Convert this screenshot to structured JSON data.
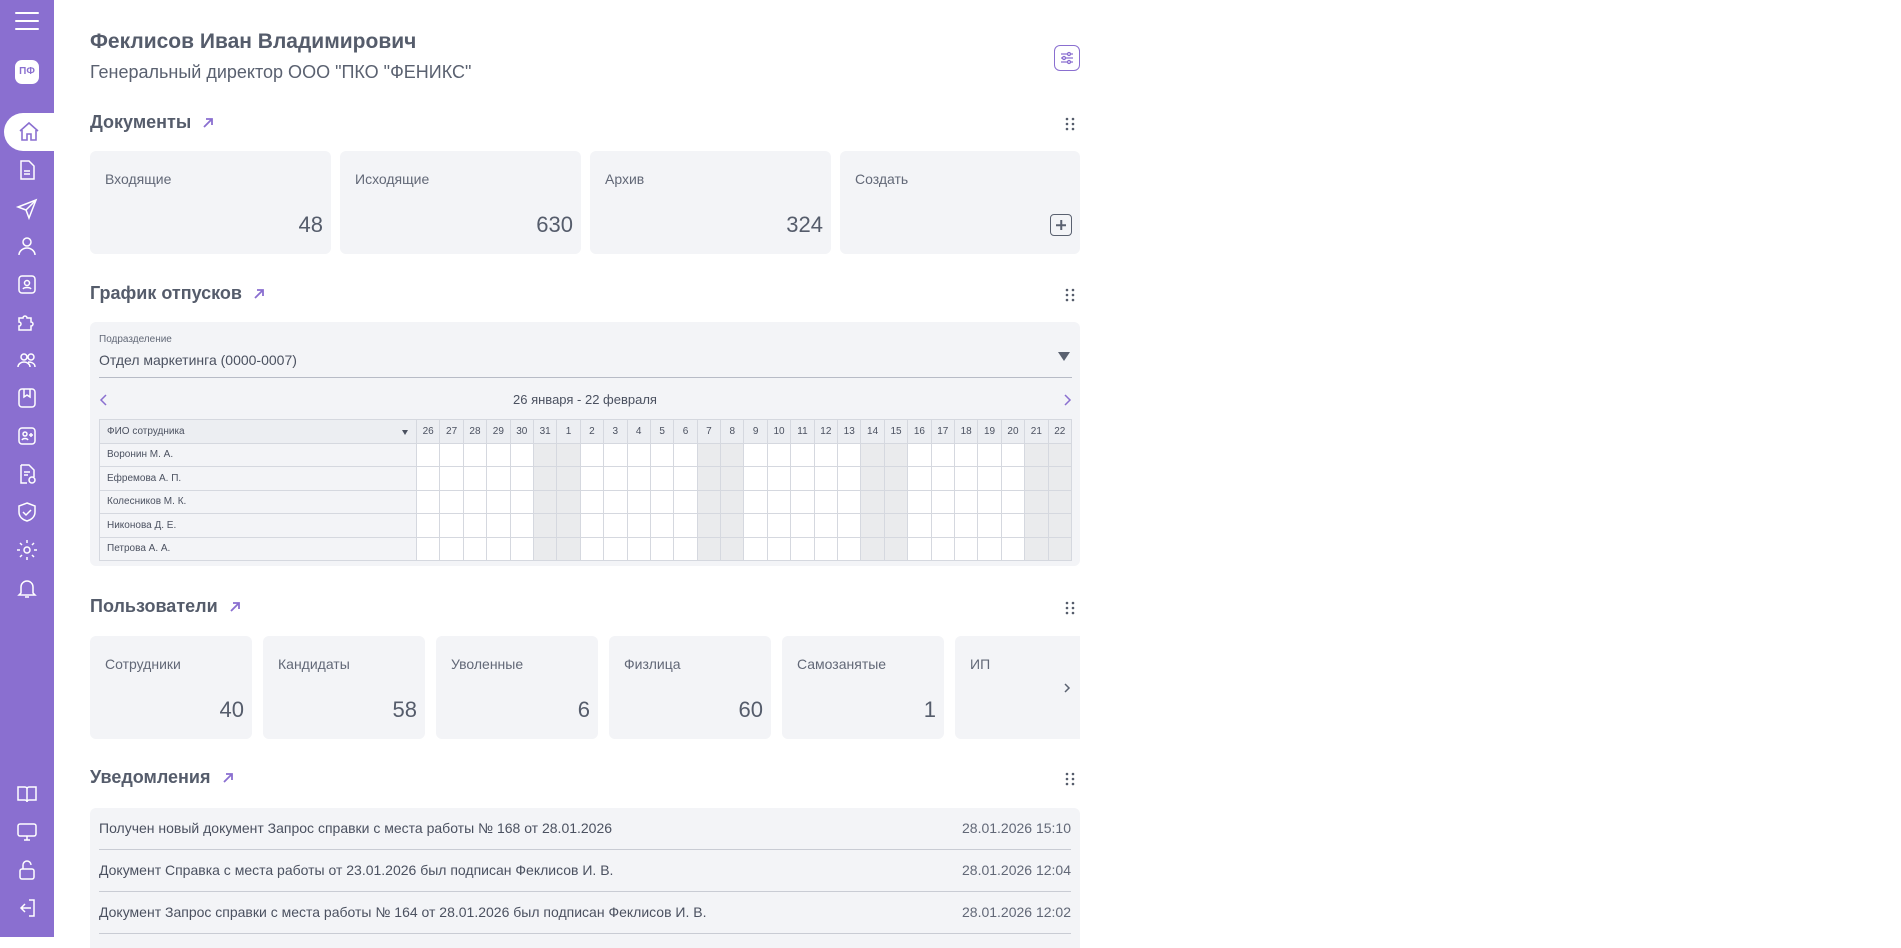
{
  "header": {
    "user_name": "Феклисов Иван Владимирович",
    "user_position": "Генеральный директор ООО \"ПКО \"ФЕНИКС\"",
    "logo_text": "ПФ"
  },
  "documents": {
    "title": "Документы",
    "cards": [
      {
        "label": "Входящие",
        "value": "48"
      },
      {
        "label": "Исходящие",
        "value": "630"
      },
      {
        "label": "Архив",
        "value": "324"
      },
      {
        "label": "Создать",
        "value": ""
      }
    ]
  },
  "vacations": {
    "title": "График отпусков",
    "dept_label": "Подразделение",
    "dept_value": "Отдел маркетинга (0000-0007)",
    "period": "26 января - 22 февраля",
    "name_header": "ФИО сотрудника",
    "days": [
      "26",
      "27",
      "28",
      "29",
      "30",
      "31",
      "1",
      "2",
      "3",
      "4",
      "5",
      "6",
      "7",
      "8",
      "9",
      "10",
      "11",
      "12",
      "13",
      "14",
      "15",
      "16",
      "17",
      "18",
      "19",
      "20",
      "21",
      "22"
    ],
    "weekend_index": [
      5,
      6,
      12,
      13,
      19,
      20,
      26,
      27
    ],
    "employees": [
      "Воронин М. А.",
      "Ефремова А. П.",
      "Колесников М. К.",
      "Никонова Д. Е.",
      "Петрова А. А."
    ]
  },
  "users": {
    "title": "Пользователи",
    "cards": [
      {
        "label": "Сотрудники",
        "value": "40"
      },
      {
        "label": "Кандидаты",
        "value": "58"
      },
      {
        "label": "Уволенные",
        "value": "6"
      },
      {
        "label": "Физлица",
        "value": "60"
      },
      {
        "label": "Самозанятые",
        "value": "1"
      },
      {
        "label": "ИП",
        "value": ""
      }
    ]
  },
  "notifications": {
    "title": "Уведомления",
    "items": [
      {
        "text": "Получен новый документ Запрос справки с места работы № 168 от 28.01.2026",
        "time": "28.01.2026 15:10"
      },
      {
        "text": "Документ Справка с места работы от 23.01.2026 был подписан Феклисов И. В.",
        "time": "28.01.2026 12:04"
      },
      {
        "text": "Документ Запрос справки с места работы № 164 от 28.01.2026 был подписан Феклисов И. В.",
        "time": "28.01.2026 12:02"
      }
    ]
  },
  "colors": {
    "accent": "#8a6fd0",
    "card_bg": "#f3f4f7"
  }
}
